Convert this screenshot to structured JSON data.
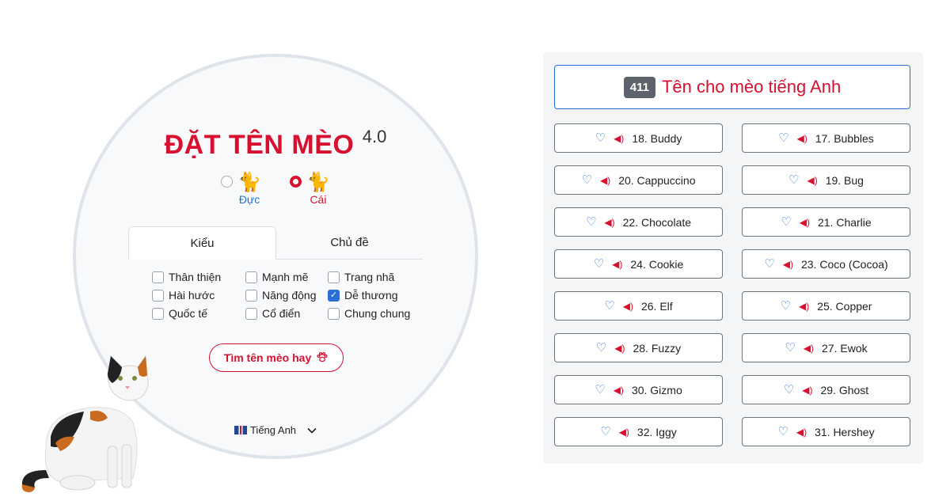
{
  "app": {
    "title": "ĐẶT TÊN MÈO",
    "version": "4.0"
  },
  "gender": {
    "male_label": "Đực",
    "female_label": "Cái",
    "selected": "female"
  },
  "tabs": [
    {
      "label": "Kiểu",
      "active": true
    },
    {
      "label": "Chủ đề",
      "active": false
    }
  ],
  "checkboxes": [
    {
      "label": "Thân thiện",
      "checked": false
    },
    {
      "label": "Mạnh mẽ",
      "checked": false
    },
    {
      "label": "Trang nhã",
      "checked": false
    },
    {
      "label": "Hài hước",
      "checked": false
    },
    {
      "label": "Năng động",
      "checked": false
    },
    {
      "label": "Dễ thương",
      "checked": true
    },
    {
      "label": "Quốc tế",
      "checked": false
    },
    {
      "label": "Cổ điển",
      "checked": false
    },
    {
      "label": "Chung chung",
      "checked": false
    }
  ],
  "find_button": {
    "label": "Tìm tên mèo hay"
  },
  "language": {
    "label": "Tiếng Anh"
  },
  "results": {
    "title": "Tên cho mèo tiếng Anh",
    "count": "411",
    "names": [
      {
        "left": "18. Buddy",
        "right": "17. Bubbles"
      },
      {
        "left": "20. Cappuccino",
        "right": "19. Bug"
      },
      {
        "left": "22. Chocolate",
        "right": "21. Charlie"
      },
      {
        "left": "24. Cookie",
        "right": "23. Coco (Cocoa)"
      },
      {
        "left": "26. Elf",
        "right": "25. Copper"
      },
      {
        "left": "28. Fuzzy",
        "right": "27. Ewok"
      },
      {
        "left": "30. Gizmo",
        "right": "29. Ghost"
      },
      {
        "left": "32. Iggy",
        "right": "31. Hershey"
      }
    ]
  },
  "icons": {
    "speaker": "speaker-icon",
    "heart": "heart-outline-icon",
    "paw": "paw-icon",
    "chevron": "chevron-down-icon",
    "flag": "uk-flag-icon"
  },
  "colors": {
    "accent_red": "#d8102f",
    "accent_blue": "#2a6fd6",
    "badge_gray": "#5c636a"
  }
}
